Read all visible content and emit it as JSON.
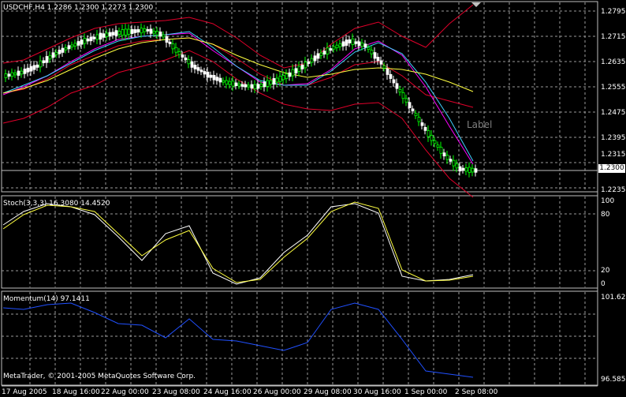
{
  "main": {
    "title": "USDCHF,H4  1.2286 1.2300 1.2273 1.2300",
    "current_price": "1.2300",
    "object_label": "Label",
    "price_axis": [
      "1.2795",
      "1.2715",
      "1.2635",
      "1.2555",
      "1.2475",
      "1.2395",
      "1.2315",
      "1.2235"
    ]
  },
  "stoch": {
    "title": "Stoch(3,3,3) 16.3080 14.4520",
    "levels": [
      "100",
      "80",
      "20",
      "0"
    ]
  },
  "momentum": {
    "title": "Momentum(14) 97.1411",
    "levels": [
      "101.623",
      "96.5851"
    ],
    "copyright": "MetaTrader, © 2001-2005 MetaQuotes Software Corp."
  },
  "time_axis": [
    "17 Aug 2005",
    "18 Aug 16:00",
    "22 Aug 00:00",
    "23 Aug 08:00",
    "24 Aug 16:00",
    "26 Aug 00:00",
    "29 Aug 08:00",
    "30 Aug 16:00",
    "1 Sep 00:00",
    "2 Sep 08:00"
  ],
  "colors": {
    "bull_candle": "#00ff00",
    "bear_candle": "#ffffff",
    "bollinger": "#e0002a",
    "ma_fast": "#ff00ff",
    "ma_mid": "#40d0ff",
    "ma_slow": "#ffff40",
    "stoch_main": "#ffffff",
    "stoch_signal": "#ffff40",
    "momentum": "#2050ff"
  }
}
